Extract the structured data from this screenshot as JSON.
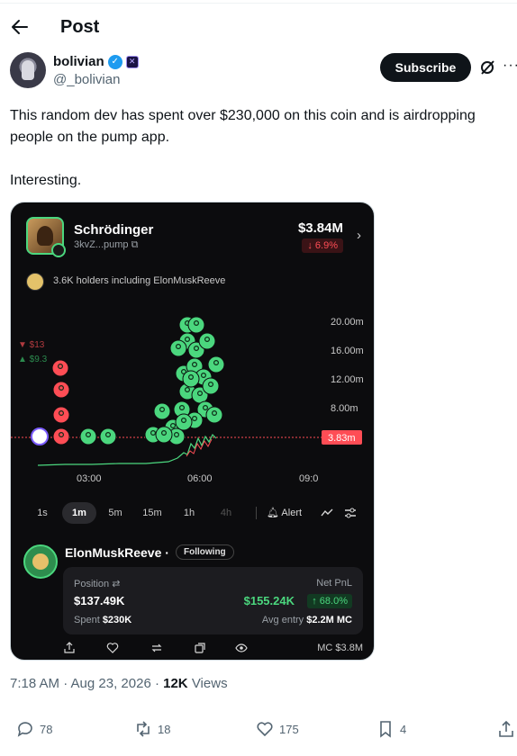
{
  "header": {
    "title": "Post"
  },
  "author": {
    "name": "bolivian",
    "handle": "@_bolivian"
  },
  "subscribe_label": "Subscribe",
  "post": {
    "line1": "This random dev has spent over $230,000 on this coin and is airdropping people on the pump app.",
    "line2": "Interesting."
  },
  "media": {
    "coin_name": "Schrödinger",
    "coin_address": "3kvZ...pump",
    "market_cap": "$3.84M",
    "change": "↓ 6.9%",
    "holders_text": "3.6K holders including ElonMuskReeve",
    "chart": {
      "y_ticks": [
        "20.00m",
        "16.00m",
        "12.00m",
        "8.00m"
      ],
      "x_ticks": [
        "03:00",
        "06:00",
        "09:0"
      ],
      "price_tag": "3.83m",
      "sell_label": "▼ $13",
      "buy_label": "▲ $9.3"
    },
    "timeframes": [
      "1s",
      "1m",
      "5m",
      "15m",
      "1h",
      "4h"
    ],
    "active_timeframe": "1m",
    "alert_label": "Alert",
    "trader": {
      "name": "ElonMuskReeve ·",
      "following": "Following",
      "position_label": "Position ⇄",
      "position_value": "$137.49K",
      "netpnl_label": "Net PnL",
      "netpnl_value": "$155.24K",
      "netpnl_pct": "↑ 68.0%",
      "spent_label": "Spent",
      "spent_value": "$230K",
      "avg_entry_label": "Avg entry",
      "avg_entry_value": "$2.2M MC"
    },
    "mc_label": "MC $3.8M"
  },
  "meta": {
    "time": "7:18 AM · Aug 23, 2026 · ",
    "views_count": "12K",
    "views_label": " Views"
  },
  "actions": {
    "replies": "78",
    "reposts": "18",
    "likes": "175",
    "bookmarks": "4"
  },
  "colors": {
    "accent_green": "#4bd77e",
    "accent_red": "#ff4d55",
    "verified_blue": "#1d9bf0"
  }
}
